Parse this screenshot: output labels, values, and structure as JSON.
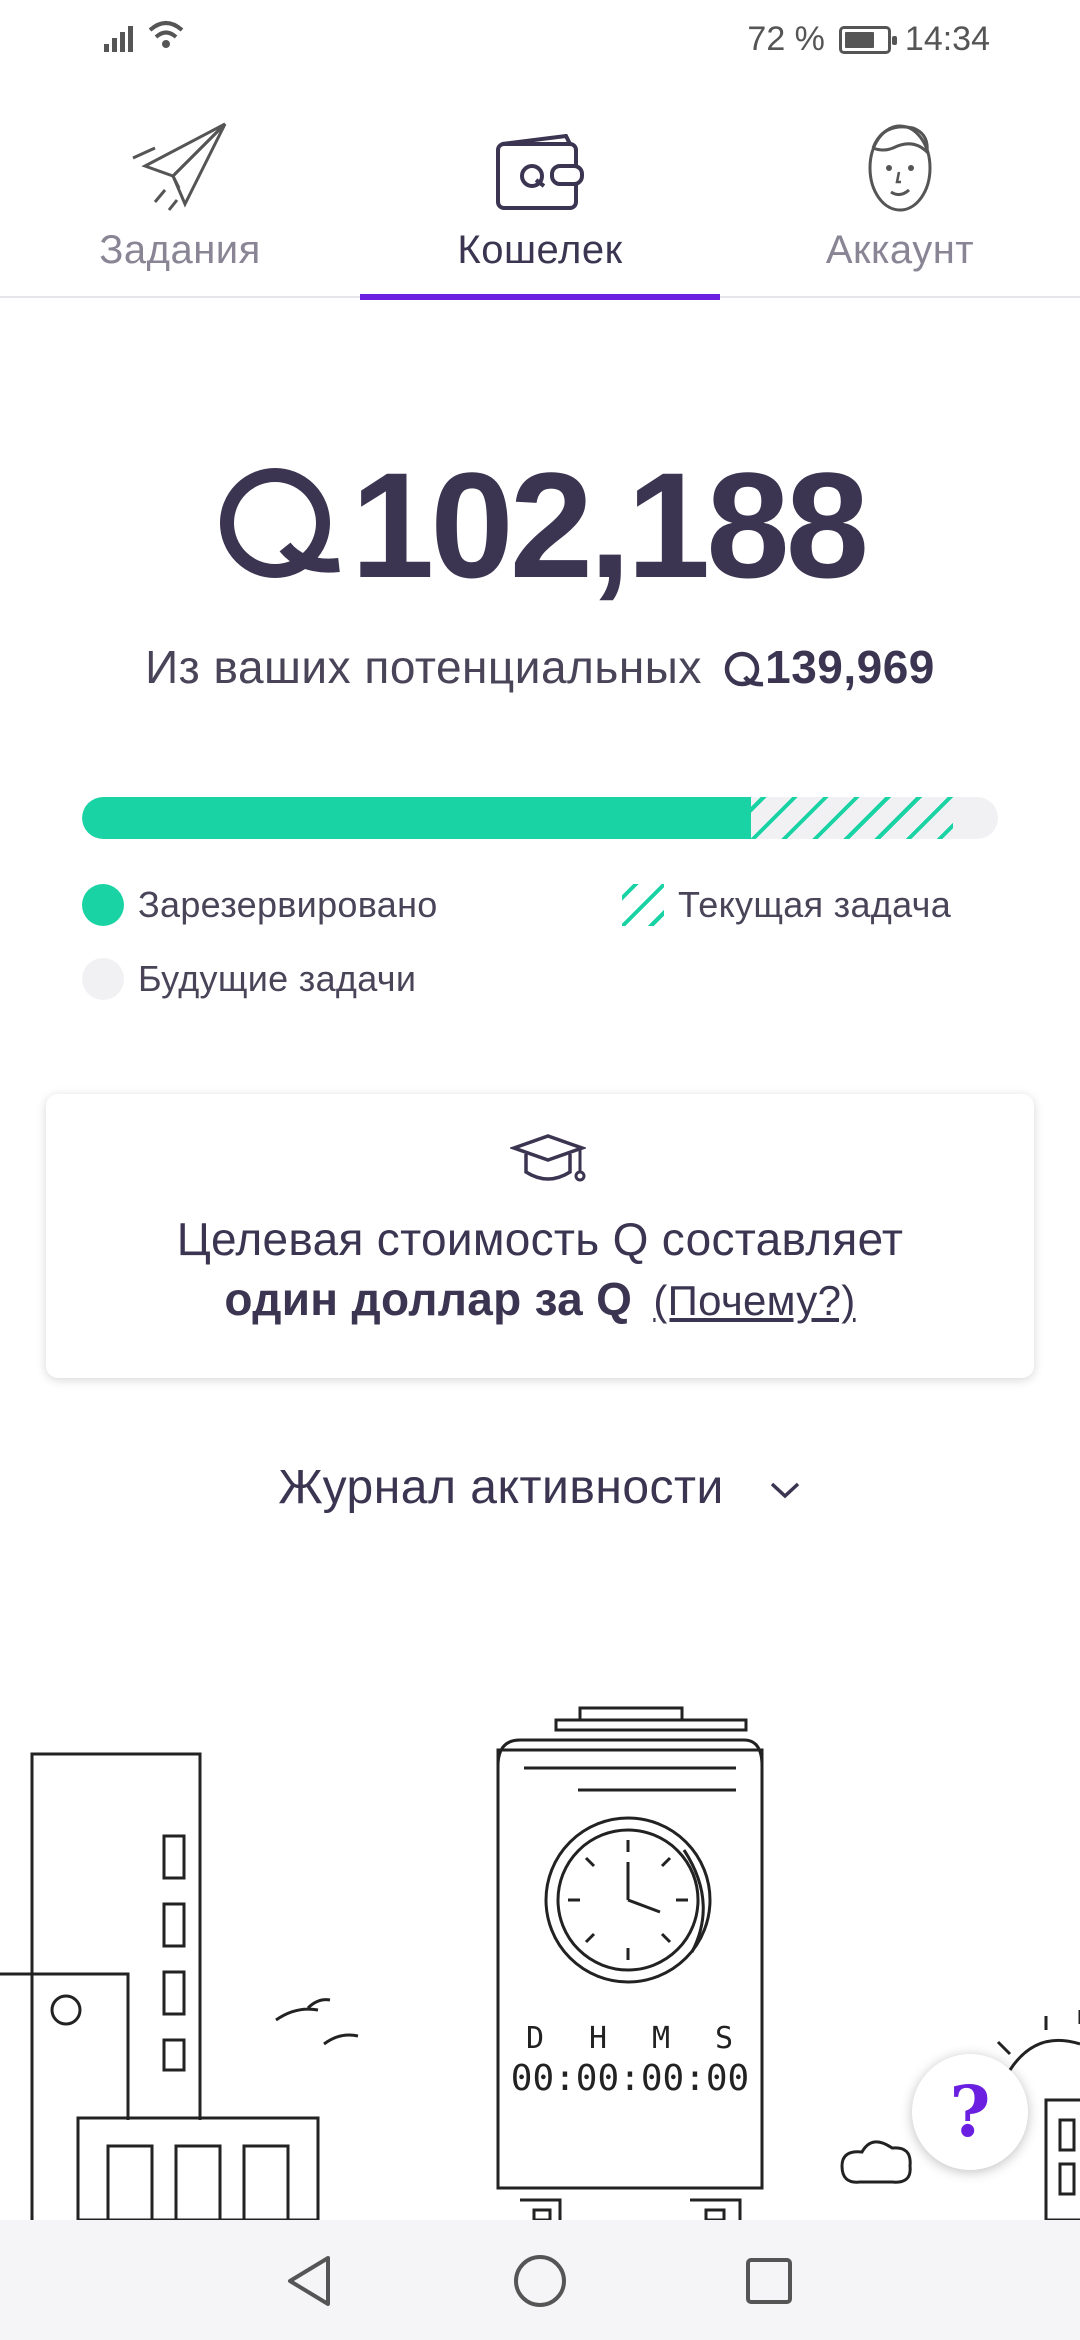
{
  "status_bar": {
    "battery": "72 %",
    "time": "14:34",
    "battery_level": 0.72
  },
  "tabs": [
    {
      "label": "Задания",
      "icon": "paper-plane-icon"
    },
    {
      "label": "Кошелек",
      "icon": "wallet-icon"
    },
    {
      "label": "Аккаунт",
      "icon": "face-icon"
    }
  ],
  "active_tab": 1,
  "balance": {
    "amount": "102,188"
  },
  "potential": {
    "prefix": "Из ваших потенциальных",
    "amount": "139,969"
  },
  "progress": {
    "reserved_fraction": 0.73,
    "current_task_fraction": 0.22
  },
  "legend": {
    "reserved": "Зарезервировано",
    "current": "Текущая задача",
    "future": "Будущие задачи"
  },
  "info_card": {
    "icon": "graduation-cap-icon",
    "line1": "Целевая стоимость Q составляет",
    "line2_bold": "один доллар за Q",
    "why_link": "(Почему?)"
  },
  "activity_log": {
    "label": "Журнал активности",
    "icon": "chevron-down-icon"
  },
  "clock_tower": {
    "labels": [
      "D",
      "H",
      "M",
      "S"
    ],
    "time": "00:00:00:00"
  },
  "help_button": {
    "label": "?"
  },
  "colors": {
    "accent": "#6b1fe0",
    "green": "#1ad3a5",
    "text": "#3b3551"
  }
}
